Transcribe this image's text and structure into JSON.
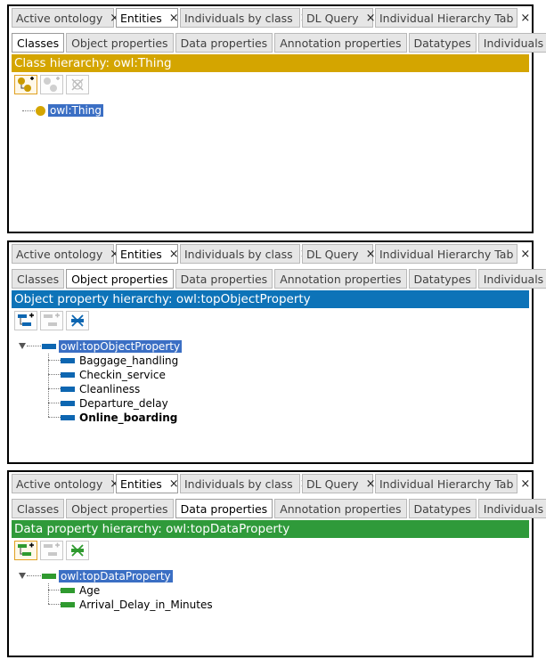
{
  "top_tabs": [
    "Active ontology",
    "Entities",
    "Individuals by class",
    "DL Query",
    "Individual Hierarchy Tab"
  ],
  "close_glyph": "×",
  "sub_tabs": [
    "Classes",
    "Object properties",
    "Data properties",
    "Annotation properties",
    "Datatypes",
    "Individuals"
  ],
  "panel1": {
    "header": "Class hierarchy: owl:Thing",
    "header_color": "#d4a500",
    "root": "owl:Thing"
  },
  "panel2": {
    "header": "Object property hierarchy: owl:topObjectProperty",
    "header_color": "#0d73b8",
    "root": "owl:topObjectProperty",
    "children": [
      "Baggage_handling",
      "Checkin_service",
      "Cleanliness",
      "Departure_delay",
      "Online_boarding"
    ]
  },
  "panel3": {
    "header": "Data property hierarchy: owl:topDataProperty",
    "header_color": "#2f9a3a",
    "root": "owl:topDataProperty",
    "children": [
      "Age",
      "Arrival_Delay_in_Minutes"
    ]
  }
}
